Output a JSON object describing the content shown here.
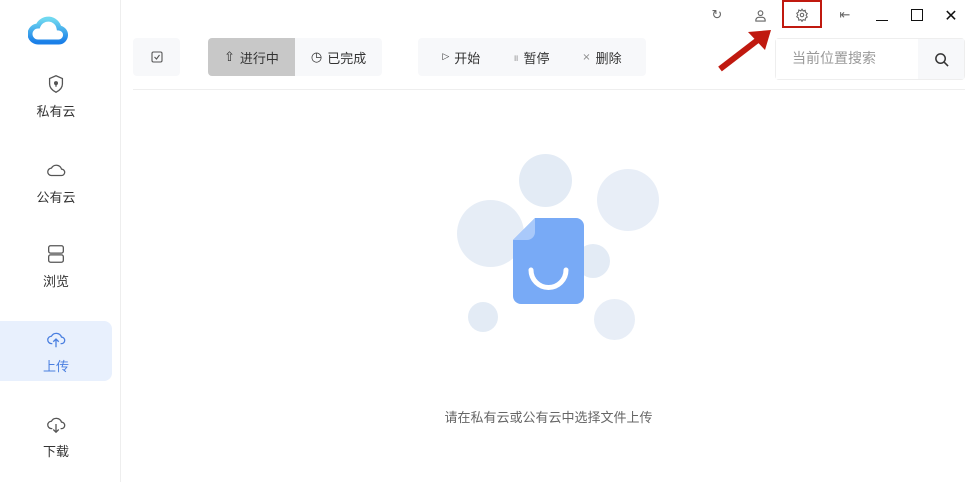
{
  "sidebar": {
    "items": [
      {
        "label": "私有云",
        "icon": "shield-icon"
      },
      {
        "label": "公有云",
        "icon": "cloud-icon"
      },
      {
        "label": "浏览",
        "icon": "browse-icon"
      },
      {
        "label": "上传",
        "icon": "cloud-upload-icon",
        "active": true
      },
      {
        "label": "下载",
        "icon": "cloud-download-icon"
      }
    ]
  },
  "toolbar": {
    "in_progress": "进行中",
    "completed": "已完成",
    "start": "开始",
    "pause": "暂停",
    "delete": "删除"
  },
  "search": {
    "placeholder": "当前位置搜索"
  },
  "empty": {
    "message": "请在私有云或公有云中选择文件上传"
  },
  "colors": {
    "accent": "#4a7fe0",
    "annotation": "#c0190f"
  }
}
